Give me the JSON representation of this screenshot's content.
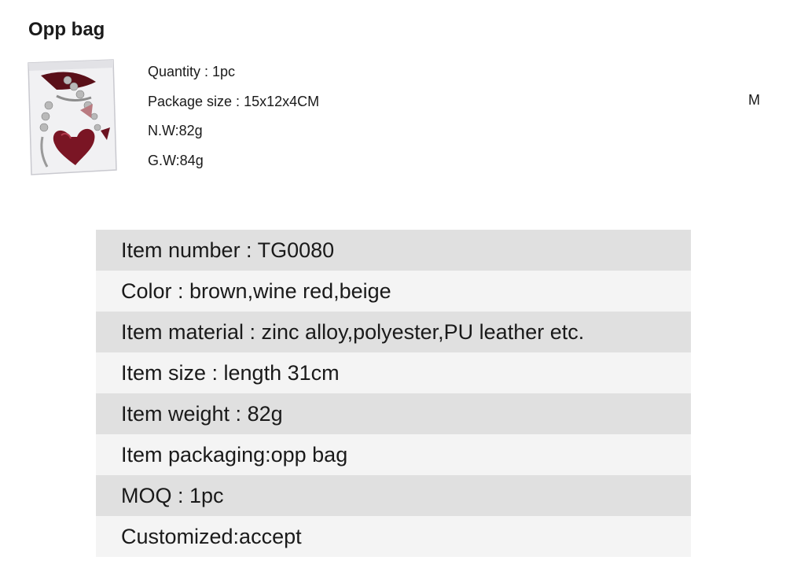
{
  "header": {
    "title": "Opp bag"
  },
  "package_info": [
    "Quantity : 1pc",
    "Package size : 15x12x4CM",
    "N.W:82g",
    "G.W:84g"
  ],
  "stray_text": "M",
  "specs": [
    "Item number : TG0080",
    "Color : brown,wine red,beige",
    "Item material : zinc alloy,polyester,PU leather etc.",
    "Item size : length 31cm",
    "Item weight : 82g",
    "Item packaging:opp bag",
    "MOQ : 1pc",
    "Customized:accept"
  ],
  "colors": {
    "row_dark": "#e0e0e0",
    "row_light": "#f4f4f4",
    "text": "#1a1a1a",
    "product": "#7a1524"
  }
}
